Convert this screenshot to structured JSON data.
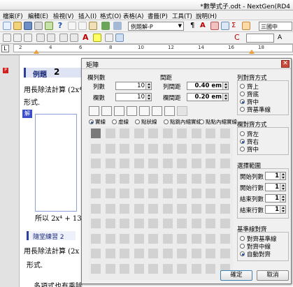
{
  "window": {
    "title": "*數學式子.odt - NextGen(RD4"
  },
  "menu": [
    "檔案(F)",
    "編輯(E)",
    "檢視(V)",
    "插入(I)",
    "格式(O)",
    "表格(A)",
    "書籤(P)",
    "工具(T)",
    "說明(H)"
  ],
  "toolbar": {
    "style_select": "例題解-P",
    "side_label": "三國中"
  },
  "ruler": {
    "numbers": [
      "2",
      "4",
      "6",
      "8",
      "10",
      "12",
      "14",
      "16",
      "18"
    ]
  },
  "document": {
    "heading_label": "例題",
    "heading_num": "2",
    "line1": "用長除法計算 (2x⁴+",
    "line2": "形式.",
    "solution_tag": "解",
    "line3": "所以 2x⁴ + 13x",
    "practice_label": "隨堂練習 2",
    "line4": "用長除法計算 (2x",
    "line5": "形式.",
    "line6": "多項式也有乘除"
  },
  "dialog": {
    "title": "矩陣",
    "cols_rows": {
      "title": "欄列數",
      "cols_label": "列數",
      "cols_value": "10",
      "rows_label": "欄數",
      "rows_value": "10"
    },
    "spacing": {
      "title": "間距",
      "row_label": "列間距",
      "row_value": "0.40 em",
      "col_label": "欄間距",
      "col_value": "0.20 em"
    },
    "col_align": {
      "title": "列對齊方式",
      "options": [
        "齊上",
        "齊底",
        "齊中",
        "齊基準線"
      ],
      "selected": 2
    },
    "line_options": [
      "實線",
      "虛線",
      "點狀線",
      "點跳內縮實線",
      "點點內縮實線"
    ],
    "selected_line": 0,
    "row_align": {
      "title": "欄對齊方式",
      "options": [
        "齊左",
        "齊右",
        "齊中"
      ],
      "selected": 1
    },
    "group": {
      "title": "選擇範圍",
      "start_col_label": "開始列數",
      "start_col": "1",
      "start_row_label": "開始行數",
      "start_row": "1",
      "end_col_label": "結束列數",
      "end_col": "1",
      "end_row_label": "結束行數",
      "end_row": "1"
    },
    "baseline": {
      "title": "基準線對齊",
      "options": [
        "對齊基準線",
        "對齊中線",
        "自動對齊"
      ],
      "selected": 2
    },
    "ok_label": "確定",
    "cancel_label": "取消"
  }
}
